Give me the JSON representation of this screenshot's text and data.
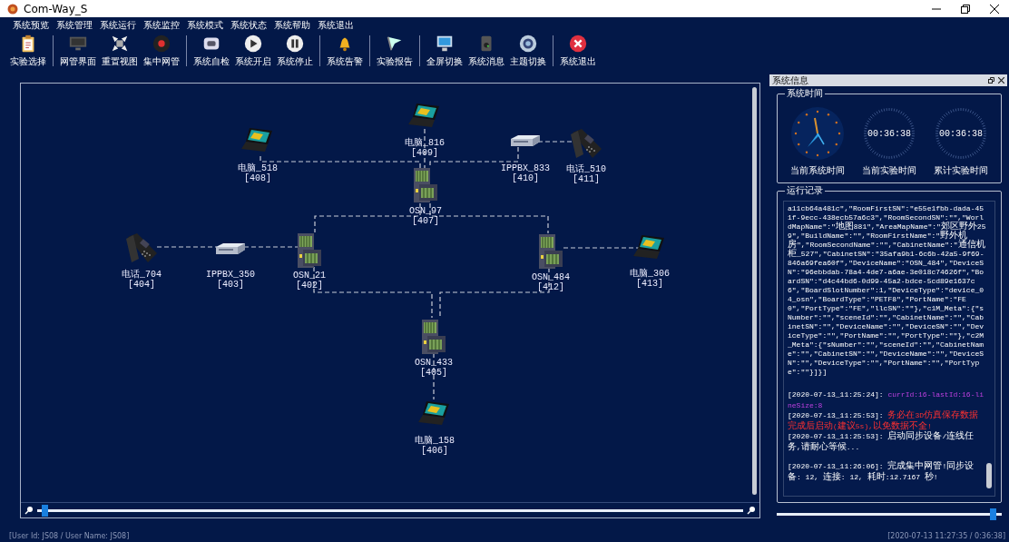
{
  "window": {
    "title": "Com-Way_S"
  },
  "menu": [
    "系统预览",
    "系统管理",
    "系统运行",
    "系统监控",
    "系统模式",
    "系统状态",
    "系统帮助",
    "系统退出"
  ],
  "toolbar": [
    [
      "实验选择"
    ],
    [
      "网管界面",
      "重置视图",
      "集中网管"
    ],
    [
      "系统自检",
      "系统开启",
      "系统停止"
    ],
    [
      "系统告警"
    ],
    [
      "实验报告"
    ],
    [
      "全屏切换",
      "系统消息",
      "主题切换"
    ],
    [
      "系统退出"
    ]
  ],
  "topology": {
    "nodes": [
      {
        "kind": "laptop",
        "name": "电脑_518",
        "id": "[408]"
      },
      {
        "kind": "laptop",
        "name": "电脑_816",
        "id": "[409]"
      },
      {
        "kind": "pbx",
        "name": "IPPBX_833",
        "id": "[410]"
      },
      {
        "kind": "phone",
        "name": "电话_510",
        "id": "[411]"
      },
      {
        "kind": "osn",
        "name": "OSN_97",
        "id": "[407]"
      },
      {
        "kind": "phone",
        "name": "电话_704",
        "id": "[404]"
      },
      {
        "kind": "pbx",
        "name": "IPPBX_350",
        "id": "[403]"
      },
      {
        "kind": "osn",
        "name": "OSN_21",
        "id": "[402]"
      },
      {
        "kind": "osn",
        "name": "OSN_484",
        "id": "[412]"
      },
      {
        "kind": "laptop",
        "name": "电脑_306",
        "id": "[413]"
      },
      {
        "kind": "osn",
        "name": "OSN_433",
        "id": "[405]"
      },
      {
        "kind": "laptop",
        "name": "电脑_158",
        "id": "[406]"
      }
    ],
    "zoom": {
      "level": 0.01
    }
  },
  "info_panel": {
    "title": "系统信息",
    "time_group": {
      "title": "系统时间",
      "clocks": [
        {
          "kind": "analog",
          "label": "当前系统时间"
        },
        {
          "kind": "digital",
          "reading": "00:36:38",
          "label": "当前实验时间"
        },
        {
          "kind": "digital",
          "reading": "00:36:38",
          "label": "累计实验时间"
        }
      ]
    },
    "log_group": {
      "title": "运行记录",
      "payload": "a11cb64a481c\",\"RoomFirstSN\":\"e55e1fbb-dada-451f-9ecc-438ecb57a6c3\",\"RoomSecondSN\":\"\",\"WorldMapName\":\"地图881\",\"AreaMapName\":\"郊区野外259\",\"BuildName\":\"\",\"RoomFirstName\":\"野外机房\",\"RoomSecondName\":\"\",\"CabinetName\":\"通信机柜_527\",\"CabinetSN\":\"35afa9b1-6c6b-42a5-9f69-846a69fea60f\",\"DeviceName\":\"OSN_484\",\"DeviceSN\":\"96ebbdab-78a4-4de7-a6ae-3e018c74626f\",\"BoardSN\":\"d4c44bd6-0d99-45a2-bdce-5cd89e1637c6\",\"BoardSlotNumber\":1,\"DeviceType\":\"device_04_osn\",\"BoardType\":\"PETF8\",\"PortName\":\"FE0\",\"PortType\":\"FE\",\"llcSN\":\"\"},\"c1M_Meta\":{\"sNumber\":\"\",\"sceneId\":\"\",\"CabinetName\":\"\",\"CabinetSN\":\"\",\"DeviceName\":\"\",\"DeviceSN\":\"\",\"DeviceType\":\"\",\"PortName\":\"\",\"PortType\":\"\"},\"c2M_Meta\":{\"sNumber\":\"\",\"sceneId\":\"\",\"CabinetName\":\"\",\"CabinetSN\":\"\",\"DeviceName\":\"\",\"DeviceSN\":\"\",\"DeviceType\":\"\",\"PortName\":\"\",\"PortType\":\"\"}]}]",
      "entries": [
        {
          "kind": "debug",
          "timestamp": "[2020-07-13_11:25:24]:",
          "message": "currId:16-lastId:16-lineSize:8"
        },
        {
          "kind": "warning",
          "timestamp": "[2020-07-13_11:25:53]:",
          "message": "务必在3D仿真保存数据完成后启动(建议5s),以免数据不全!"
        },
        {
          "kind": "info",
          "timestamp": "[2020-07-13_11:25:53]:",
          "message": "启动同步设备/连线任务,请耐心等候..."
        },
        {
          "kind": "info",
          "timestamp": "[2020-07-13_11:26:06]:",
          "message": "完成集中网管!同步设备: 12, 连接: 12, 耗时:12.7167 秒!"
        }
      ]
    },
    "slider": {
      "level": 0.96
    }
  },
  "status_bar": {
    "user": "[User Id: JS08 / User Name: JS08]",
    "clock": "[2020-07-13 11:27:35 / 0:36:38]"
  }
}
